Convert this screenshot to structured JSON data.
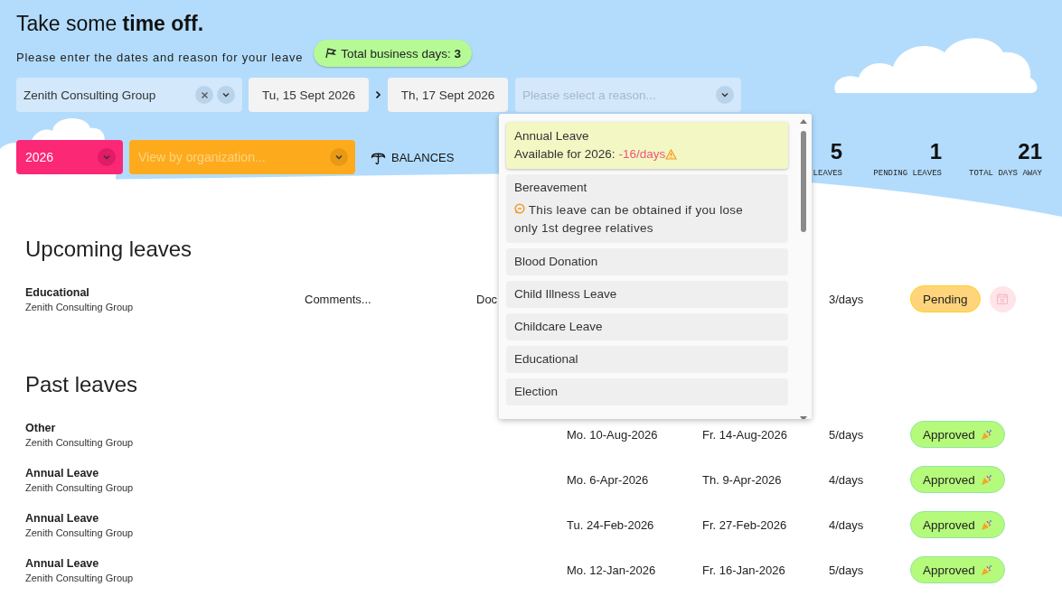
{
  "header": {
    "title": "Take some **time off.**",
    "subtitle": "Please enter the dates and reason for your leave",
    "business_days": {
      "label": "Total business days:",
      "value": "3"
    }
  },
  "form": {
    "organization": "Zenith Consulting Group",
    "start_date": "Tu, 15 Sept 2026",
    "end_date": "Th, 17 Sept 2026",
    "reason_placeholder": "Please select a reason...",
    "expanded": true
  },
  "filters": {
    "year": "2026",
    "organization_placeholder": "View by organization...",
    "balances": "BALANCES"
  },
  "stats": [
    {
      "value": "5",
      "label": "LEAVES"
    },
    {
      "value": "1",
      "label": "PENDING LEAVES"
    },
    {
      "value": "21",
      "label": "TOTAL DAYS AWAY"
    }
  ],
  "reason_options": [
    {
      "name": "Annual Leave",
      "selected": true,
      "availability": "Available for 2026:",
      "amount": "-16/days",
      "warning": true
    },
    {
      "name": "Bereavement",
      "selected": false,
      "note": "This leave can be obtained if you lose only 1st degree relatives"
    },
    {
      "name": "Blood Donation",
      "selected": false
    },
    {
      "name": "Child Illness Leave",
      "selected": false
    },
    {
      "name": "Childcare Leave",
      "selected": false
    },
    {
      "name": "Educational",
      "selected": false
    },
    {
      "name": "Election",
      "selected": false
    }
  ],
  "upcoming": {
    "title": "Upcoming leaves",
    "rows": [
      {
        "type": "Educational",
        "organization": "Zenith Consulting Group",
        "comments": "Comments...",
        "document": "Doc",
        "days": "3/days",
        "status": "Pending",
        "kind": "pending",
        "cancelable": true
      }
    ]
  },
  "past": {
    "title": "Past leaves",
    "rows": [
      {
        "type": "Other",
        "organization": "Zenith Consulting Group",
        "start": "Mo. 10-Aug-2026",
        "end": "Fr. 14-Aug-2026",
        "days": "5/days",
        "status": "Approved",
        "kind": "approved",
        "cancelable": false
      },
      {
        "type": "Annual Leave",
        "organization": "Zenith Consulting Group",
        "start": "Mo. 6-Apr-2026",
        "end": "Th. 9-Apr-2026",
        "days": "4/days",
        "status": "Approved",
        "kind": "approved",
        "cancelable": false
      },
      {
        "type": "Annual Leave",
        "organization": "Zenith Consulting Group",
        "start": "Tu. 24-Feb-2026",
        "end": "Fr. 27-Feb-2026",
        "days": "4/days",
        "status": "Approved",
        "kind": "approved",
        "cancelable": false
      },
      {
        "type": "Annual Leave",
        "organization": "Zenith Consulting Group",
        "start": "Mo. 12-Jan-2026",
        "end": "Fr. 16-Jan-2026",
        "days": "5/days",
        "status": "Approved",
        "kind": "approved",
        "cancelable": false
      }
    ]
  }
}
